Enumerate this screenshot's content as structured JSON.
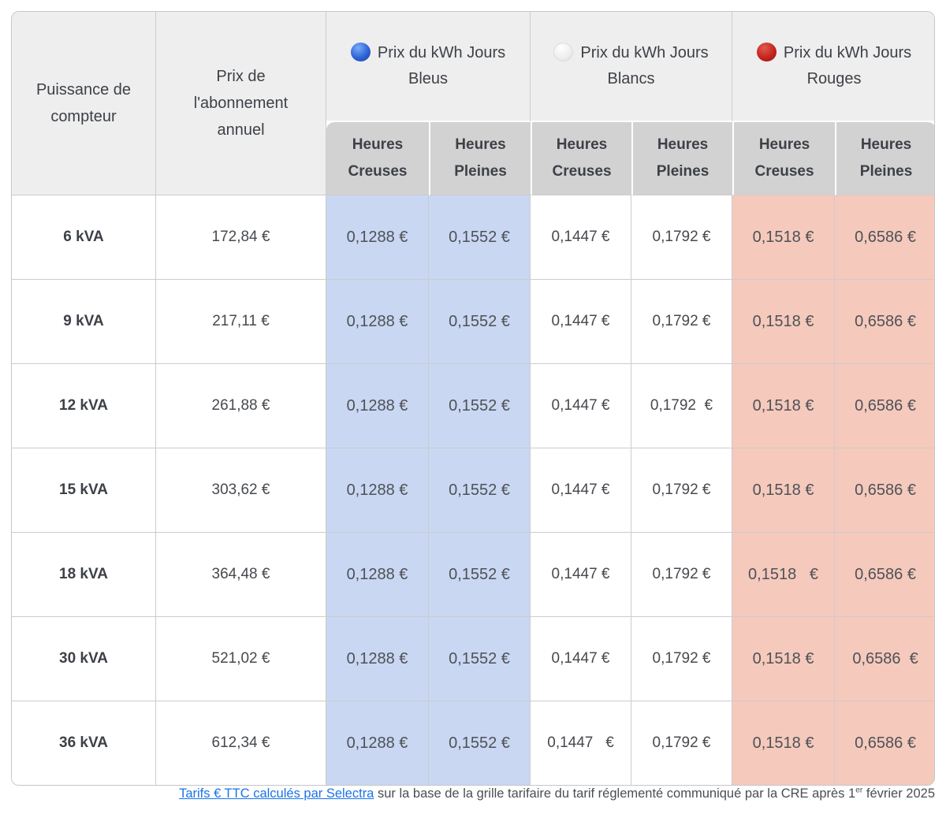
{
  "header": {
    "power_label": "Puissance de compteur",
    "subscription_label": "Prix de l'abonnement annuel",
    "groups": [
      {
        "icon": "blue-circle",
        "label": "Prix du kWh Jours Bleus"
      },
      {
        "icon": "white-circle",
        "label": "Prix du kWh Jours Blancs"
      },
      {
        "icon": "red-circle",
        "label": "Prix du kWh Jours Rouges"
      }
    ],
    "sub_labels": [
      "Heures Creuses",
      "Heures Pleines",
      "Heures Creuses",
      "Heures Pleines",
      "Heures Creuses",
      "Heures Pleines"
    ]
  },
  "rows": [
    {
      "power": "6 kVA",
      "subscription": "172,84 €",
      "blue_hc": "0,1288 €",
      "blue_hp": "0,1552 €",
      "white_hc": "0,1447 €",
      "white_hp": "0,1792 €",
      "red_hc": "0,1518 €",
      "red_hp": "0,6586 €"
    },
    {
      "power": "9 kVA",
      "subscription": "217,11 €",
      "blue_hc": "0,1288 €",
      "blue_hp": "0,1552 €",
      "white_hc": "0,1447 €",
      "white_hp": "0,1792 €",
      "red_hc": "0,1518 €",
      "red_hp": "0,6586 €"
    },
    {
      "power": "12 kVA",
      "subscription": "261,88 €",
      "blue_hc": "0,1288 €",
      "blue_hp": "0,1552 €",
      "white_hc": "0,1447 €",
      "white_hp": "0,1792  €",
      "red_hc": "0,1518 €",
      "red_hp": "0,6586 €"
    },
    {
      "power": "15 kVA",
      "subscription": "303,62 €",
      "blue_hc": "0,1288 €",
      "blue_hp": "0,1552 €",
      "white_hc": "0,1447 €",
      "white_hp": "0,1792 €",
      "red_hc": "0,1518 €",
      "red_hp": "0,6586 €"
    },
    {
      "power": "18 kVA",
      "subscription": "364,48 €",
      "blue_hc": "0,1288 €",
      "blue_hp": "0,1552 €",
      "white_hc": "0,1447 €",
      "white_hp": "0,1792 €",
      "red_hc": "0,1518   €",
      "red_hp": "0,6586 €"
    },
    {
      "power": "30 kVA",
      "subscription": "521,02 €",
      "blue_hc": "0,1288 €",
      "blue_hp": "0,1552 €",
      "white_hc": "0,1447 €",
      "white_hp": "0,1792 €",
      "red_hc": "0,1518 €",
      "red_hp": "0,6586  €"
    },
    {
      "power": "36 kVA",
      "subscription": "612,34 €",
      "blue_hc": "0,1288 €",
      "blue_hp": "0,1552 €",
      "white_hc": "0,1447   €",
      "white_hp": "0,1792 €",
      "red_hc": "0,1518 €",
      "red_hp": "0,6586 €"
    }
  ],
  "footer": {
    "link_text": "Tarifs € TTC calculés par Selectra",
    "text_before_sup": " sur la base de la grille tarifaire du tarif réglementé communiqué par la CRE après 1",
    "sup": "er",
    "text_after_sup": " février 2025"
  },
  "colors": {
    "header_bg": "#eeeeee",
    "subheader_bg": "#d2d2d2",
    "blue_cell_bg": "#c9d7f2",
    "red_cell_bg": "#f5c9bc",
    "border": "#cccccc",
    "link": "#1a73e8",
    "blue_dot": "#2e63d8",
    "white_dot": "#eeeeee",
    "red_dot": "#c5251d"
  }
}
